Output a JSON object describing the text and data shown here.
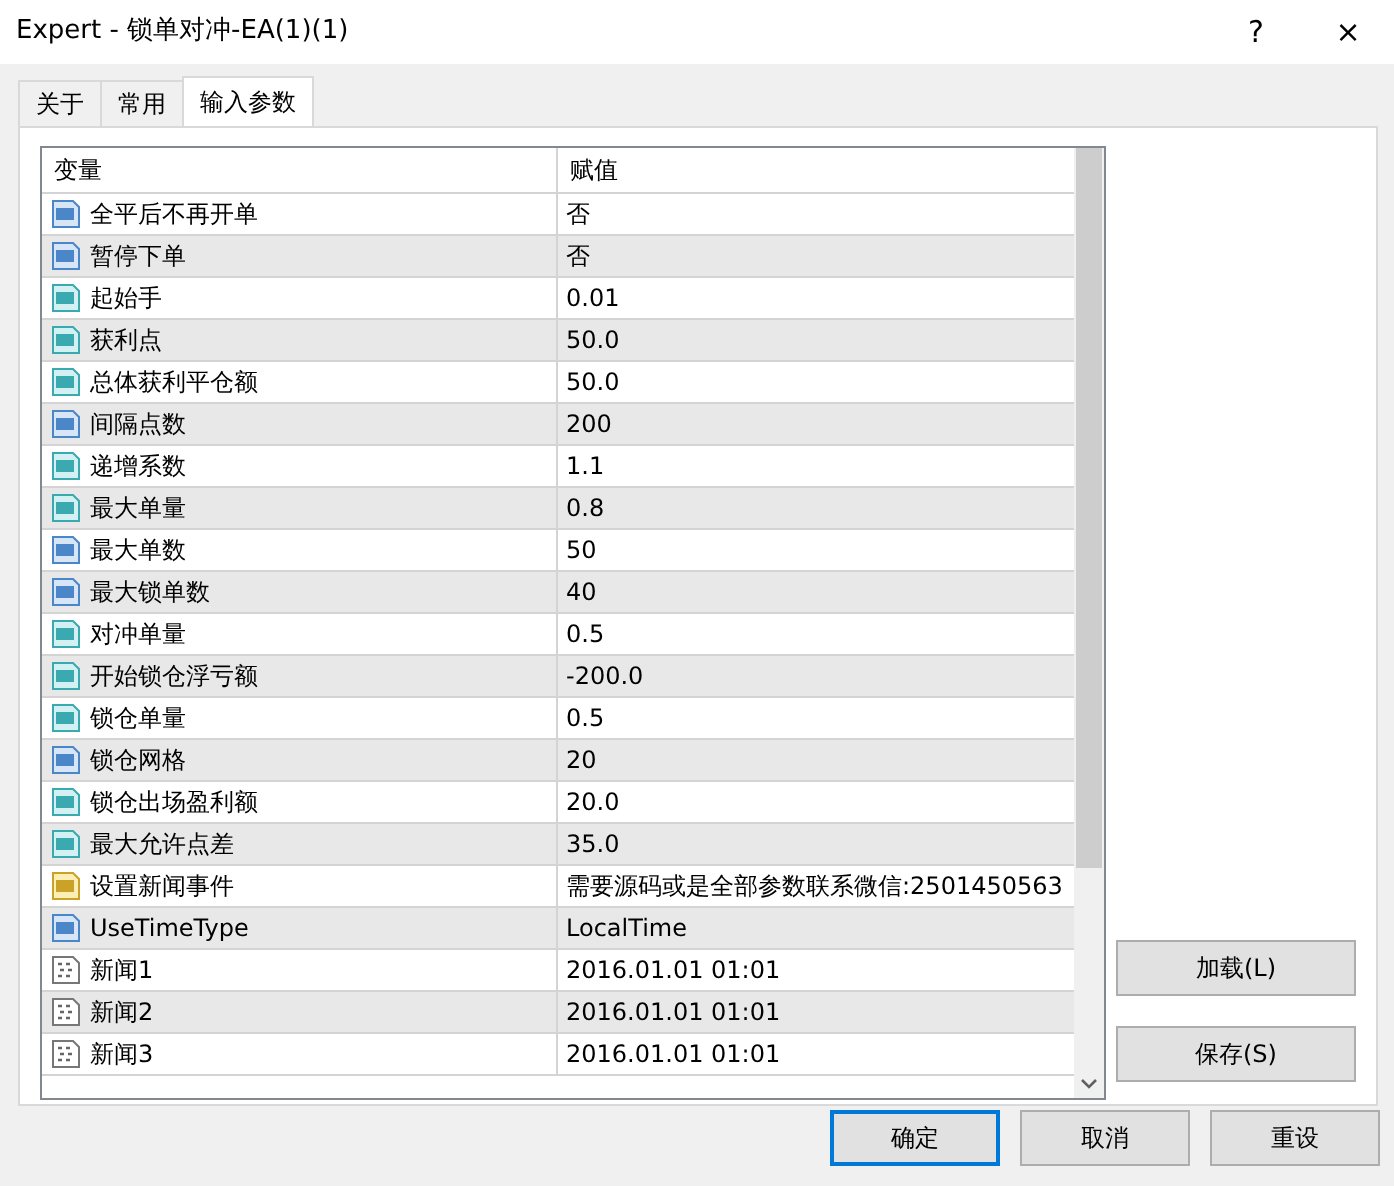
{
  "window": {
    "title": "Expert - 锁单对冲-EA(1)(1)",
    "help": "?",
    "close": "×"
  },
  "tabs": [
    {
      "label": "关于",
      "selected": false
    },
    {
      "label": "常用",
      "selected": false
    },
    {
      "label": "输入参数",
      "selected": true
    }
  ],
  "table": {
    "columns": [
      "变量",
      "赋值"
    ],
    "rows": [
      {
        "kind": "int",
        "name": "全平后不再开单",
        "value": "否"
      },
      {
        "kind": "int",
        "name": "暂停下单",
        "value": "否"
      },
      {
        "kind": "double",
        "name": "起始手",
        "value": "0.01"
      },
      {
        "kind": "double",
        "name": "获利点",
        "value": "50.0"
      },
      {
        "kind": "double",
        "name": "总体获利平仓额",
        "value": "50.0"
      },
      {
        "kind": "int",
        "name": "间隔点数",
        "value": "200"
      },
      {
        "kind": "double",
        "name": "递增系数",
        "value": "1.1"
      },
      {
        "kind": "double",
        "name": "最大单量",
        "value": "0.8"
      },
      {
        "kind": "int",
        "name": "最大单数",
        "value": "50"
      },
      {
        "kind": "int",
        "name": "最大锁单数",
        "value": "40"
      },
      {
        "kind": "double",
        "name": "对冲单量",
        "value": "0.5"
      },
      {
        "kind": "double",
        "name": "开始锁仓浮亏额",
        "value": "-200.0"
      },
      {
        "kind": "double",
        "name": "锁仓单量",
        "value": "0.5"
      },
      {
        "kind": "int",
        "name": "锁仓网格",
        "value": "20"
      },
      {
        "kind": "double",
        "name": "锁仓出场盈利额",
        "value": "20.0"
      },
      {
        "kind": "double",
        "name": "最大允许点差",
        "value": "35.0"
      },
      {
        "kind": "string",
        "name": "设置新闻事件",
        "value": "需要源码或是全部参数联系微信:2501450563"
      },
      {
        "kind": "int",
        "name": "UseTimeType",
        "value": "LocalTime"
      },
      {
        "kind": "datetime",
        "name": "新闻1",
        "value": "2016.01.01 01:01"
      },
      {
        "kind": "datetime",
        "name": "新闻2",
        "value": "2016.01.01 01:01"
      },
      {
        "kind": "datetime",
        "name": "新闻3",
        "value": "2016.01.01 01:01"
      }
    ]
  },
  "side_buttons": [
    "加载(L)",
    "保存(S)"
  ],
  "buttons": [
    {
      "label": "确定",
      "default": true
    },
    {
      "label": "取消",
      "default": false
    },
    {
      "label": "重设",
      "default": false
    }
  ]
}
